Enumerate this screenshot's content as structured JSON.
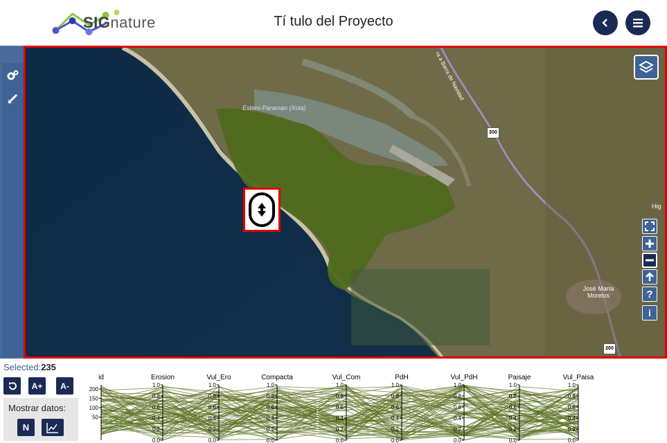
{
  "header": {
    "brand_bold": "SIG",
    "brand_light": "nature",
    "title": "Tí tulo del Proyecto"
  },
  "map": {
    "labels": {
      "estero": "Estero Paraman (Xola)",
      "road": "ra a Barra de Navidad",
      "town": "José María Morelos",
      "edge_label": "Hig",
      "shield_top": "200",
      "shield_bottom": "200"
    },
    "controls": [
      "fullscreen-icon",
      "zoom-in-icon",
      "zoom-out-icon",
      "arrow-up-icon",
      "help-icon",
      "info-icon"
    ],
    "colors": {
      "polygon": "#4e6a1e",
      "frame": "#e00000",
      "button": "#3f6396"
    }
  },
  "bottom": {
    "selected_label": "Selected:",
    "selected_count": "235",
    "font_up": "A+",
    "font_down": "A-",
    "mostrar_label": "Mostrar datos:",
    "n_button": "N"
  },
  "chart_data": {
    "type": "parallel_coordinates",
    "axes": [
      "id",
      "Erosion",
      "Vul_Ero",
      "Compacta",
      "Vul_Com",
      "PdH",
      "Vul_PdH",
      "Paisaje",
      "Vul_Paisa"
    ],
    "id_ticks": [
      "200",
      "150",
      "100",
      "50"
    ],
    "unit_ticks": [
      "1.0",
      "0.8",
      "0.6",
      "0.4",
      "0.2",
      "0.0"
    ],
    "line_color": "#5a7020",
    "selected_count": 235
  }
}
